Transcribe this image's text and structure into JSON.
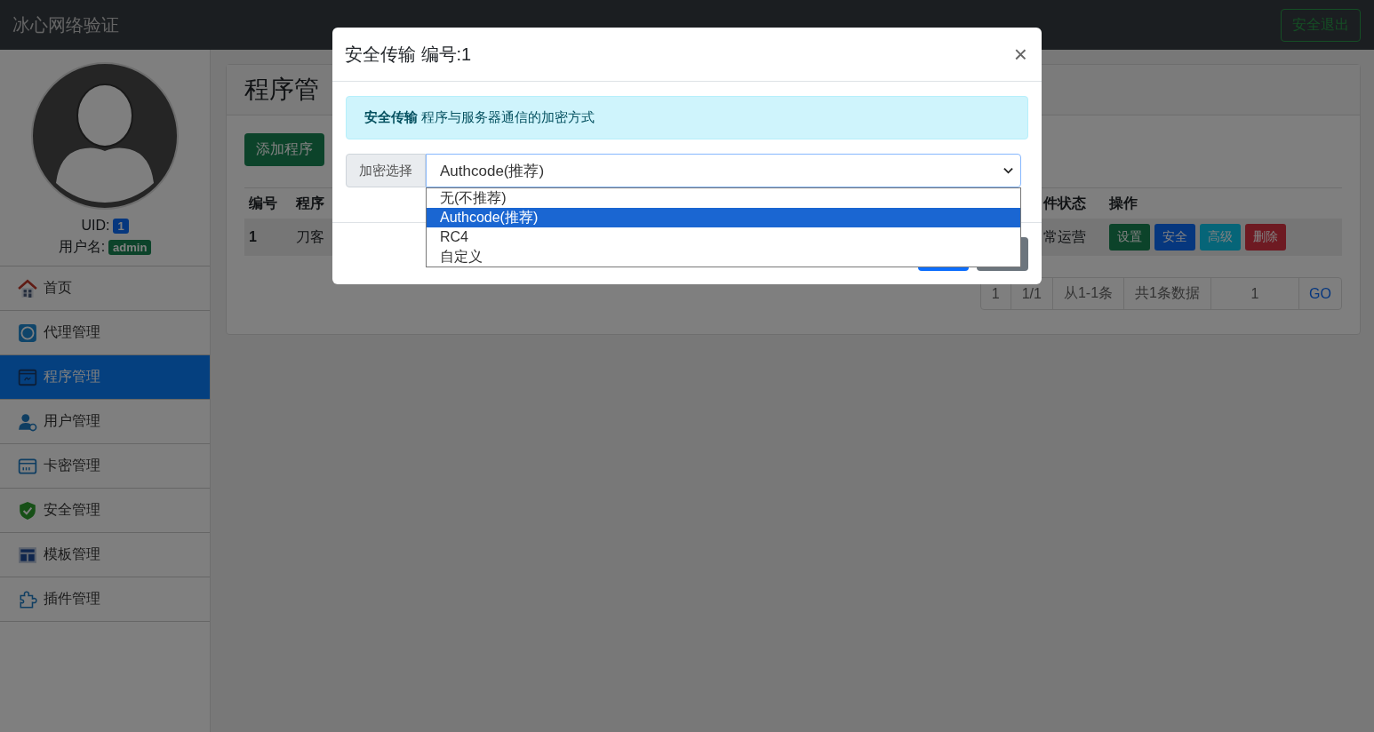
{
  "navbar": {
    "brand": "冰心网络验证",
    "logout_button": "安全退出"
  },
  "sidebar": {
    "uid_label": "UID:",
    "uid": "1",
    "username_label": "用户名:",
    "username": "admin",
    "items": [
      {
        "label": "首页",
        "selected": false
      },
      {
        "label": "代理管理",
        "selected": false
      },
      {
        "label": "程序管理",
        "selected": true
      },
      {
        "label": "用户管理",
        "selected": false
      },
      {
        "label": "卡密管理",
        "selected": false
      },
      {
        "label": "安全管理",
        "selected": false
      },
      {
        "label": "模板管理",
        "selected": false
      },
      {
        "label": "插件管理",
        "selected": false
      }
    ]
  },
  "page": {
    "title": "程序管",
    "add_button": "添加程序",
    "table": {
      "columns": [
        "编号",
        "程序",
        "件状态",
        "操作"
      ],
      "rows": [
        {
          "cells": [
            "1",
            "刀客",
            "常运营"
          ],
          "actions": [
            {
              "label": "设置",
              "kind": "success"
            },
            {
              "label": "安全",
              "kind": "primary"
            },
            {
              "label": "高级",
              "kind": "info"
            },
            {
              "label": "删除",
              "kind": "danger"
            }
          ]
        }
      ]
    },
    "pagination": {
      "items": [
        "1",
        "1/1",
        "从1-1条",
        "共1条数据"
      ],
      "page_input": "1",
      "go_button": "GO"
    }
  },
  "modal": {
    "title": "安全传输 编号:1",
    "close": "×",
    "alert": "**安全传输** 程序与服务器通信的加密方式",
    "select_label": "加密选择",
    "select_value": "Authcode(推荐)",
    "options": [
      {
        "label": "无(不推荐)",
        "selected": false
      },
      {
        "label": "Authcode(推荐)",
        "selected": true
      },
      {
        "label": "RC4",
        "selected": false
      },
      {
        "label": "自定义",
        "selected": false
      }
    ]
  }
}
